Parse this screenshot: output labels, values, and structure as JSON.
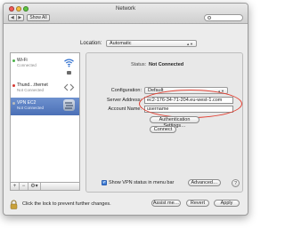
{
  "window": {
    "title": "Network"
  },
  "toolbar": {
    "back_label": "◀",
    "forward_label": "▶",
    "show_all_label": "Show All"
  },
  "location": {
    "label": "Location:",
    "value": "Automatic"
  },
  "services": [
    {
      "name": "Wi-Fi",
      "state": "Connected",
      "status_color": "#4cb34a",
      "icon": "wifi-icon"
    },
    {
      "name": "Thund…thernet",
      "state": "Not Connected",
      "status_color": "#d63a32",
      "icon": "arrows-icon"
    },
    {
      "name": "VPN EC2",
      "state": "Not Connected",
      "status_color": "#bcbcbc",
      "icon": "vpn-icon"
    }
  ],
  "sidebar_bar": {
    "add_label": "+",
    "remove_label": "−",
    "gear_label": "⚙▾"
  },
  "detail": {
    "status_label": "Status:",
    "status_value": "Not Connected",
    "configuration_label": "Configuration:",
    "configuration_value": "Default",
    "server_label": "Server Address:",
    "server_value": "ec2-176-34-71-204.eu-west-1.com",
    "account_label": "Account Name:",
    "account_value": "username",
    "auth_button": "Authentication Settings…",
    "connect_button": "Connect",
    "vpn_menu_label": "Show VPN status in menu bar",
    "advanced_button": "Advanced…",
    "help_label": "?"
  },
  "bottom": {
    "lock_text": "Click the lock to prevent further changes.",
    "assist_button": "Assist me…",
    "revert_button": "Revert",
    "apply_button": "Apply"
  },
  "colors": {
    "selection": "#4b70b6",
    "highlight_oval": "#e23d2f",
    "checkbox": "#2f6fcf"
  }
}
